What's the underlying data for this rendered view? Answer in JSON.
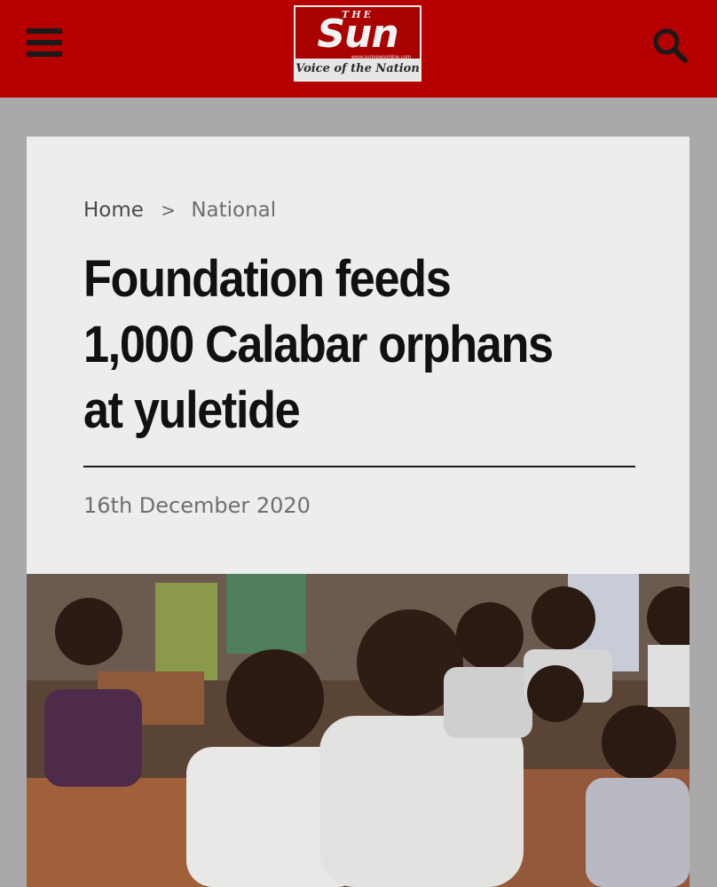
{
  "header": {
    "logo": {
      "prefix": "THE",
      "wordmark": "Sun",
      "url": "www.sunnewsonline.com",
      "tagline": "Voice of the Nation"
    },
    "menu_icon": "hamburger-menu-icon",
    "search_icon": "search-icon",
    "brand_color": "#b60000"
  },
  "breadcrumb": {
    "home": "Home",
    "separator": ">",
    "current": "National"
  },
  "article": {
    "headline": "Foundation feeds 1,000 Calabar orphans at yuletide",
    "date": "16th December 2020"
  }
}
